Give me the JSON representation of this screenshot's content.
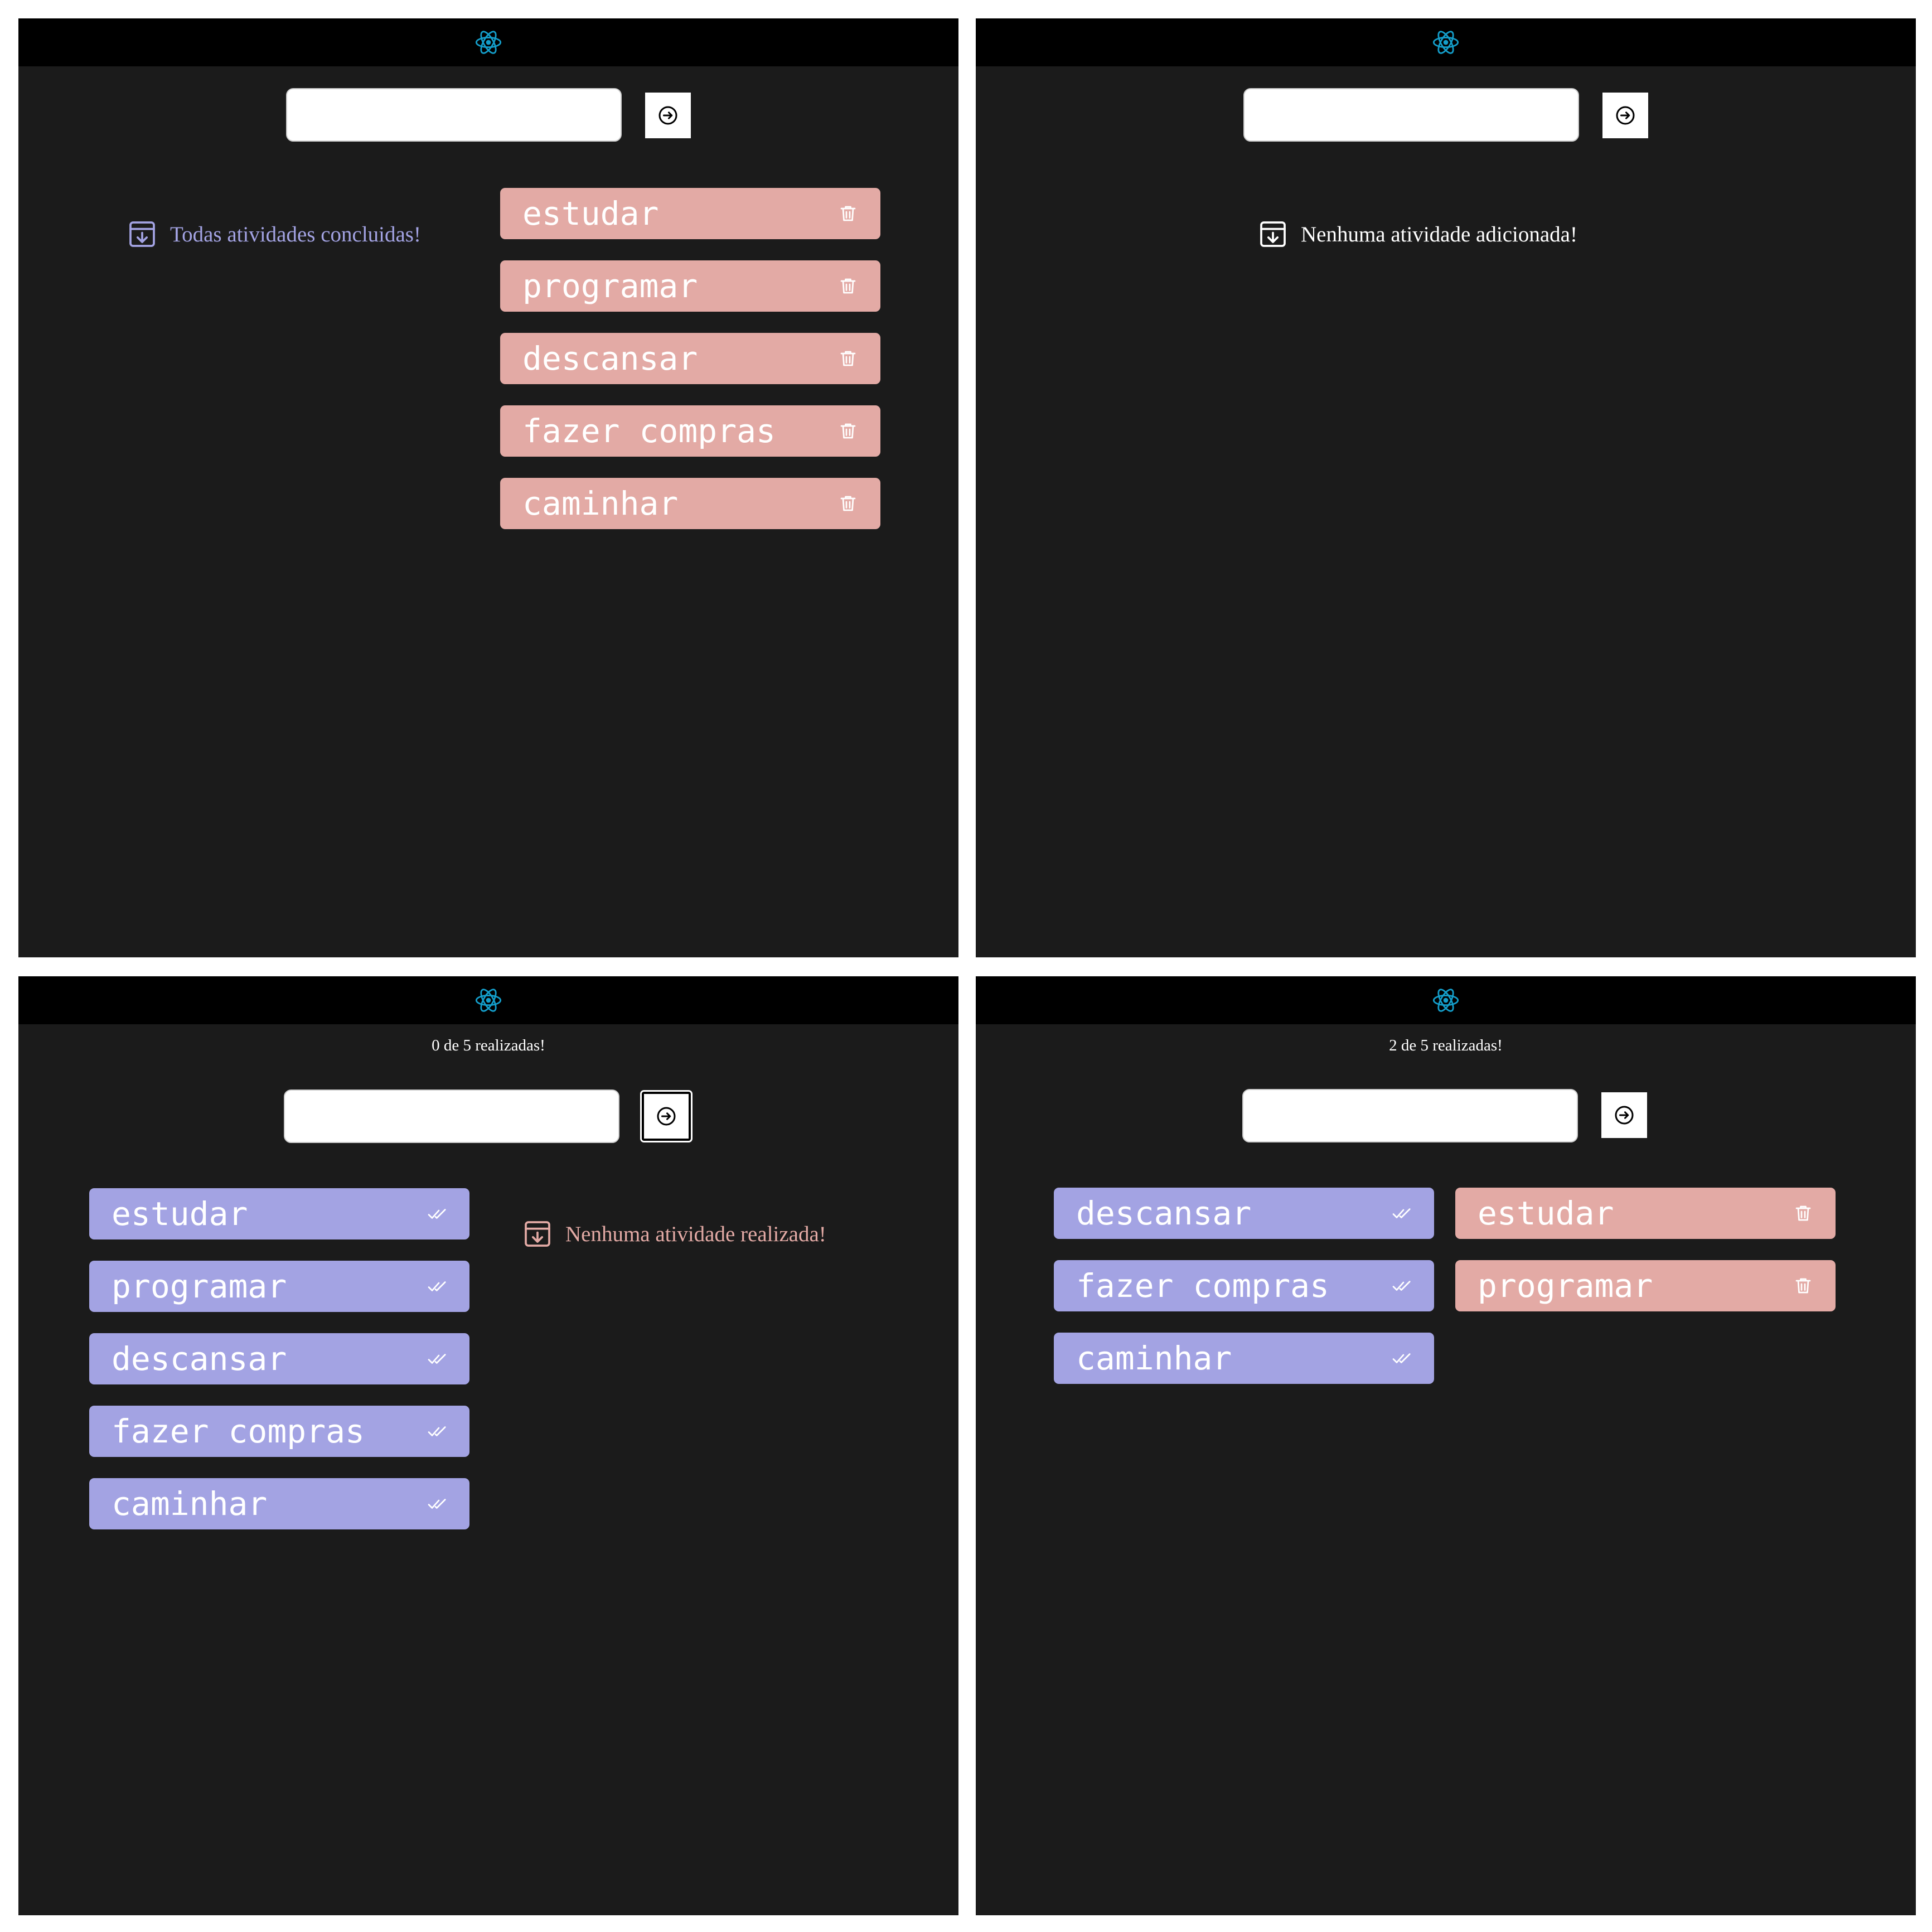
{
  "colors": {
    "topbar": "#000000",
    "background": "#1b1b1b",
    "pending_task": "#e3aaa5",
    "done_task": "#a3a3e3",
    "react_logo": "#149eca"
  },
  "icons": {
    "logo": "react-logo-icon",
    "submit": "arrow-right-circle-icon",
    "empty": "archive-download-icon",
    "delete": "trash-icon",
    "done": "double-check-icon"
  },
  "panels": [
    {
      "empty_message": "Todas atividades concluidas!",
      "pending_tasks": [
        "estudar",
        "programar",
        "descansar",
        "fazer compras",
        "caminhar"
      ]
    },
    {
      "empty_message": "Nenhuma atividade adicionada!"
    },
    {
      "counter": "0 de 5 realizadas!",
      "done_tasks": [
        "estudar",
        "programar",
        "descansar",
        "fazer compras",
        "caminhar"
      ],
      "empty_message": "Nenhuma atividade realizada!"
    },
    {
      "counter": "2 de 5 realizadas!",
      "done_tasks": [
        "descansar",
        "fazer compras",
        "caminhar"
      ],
      "pending_tasks": [
        "estudar",
        "programar"
      ]
    }
  ]
}
